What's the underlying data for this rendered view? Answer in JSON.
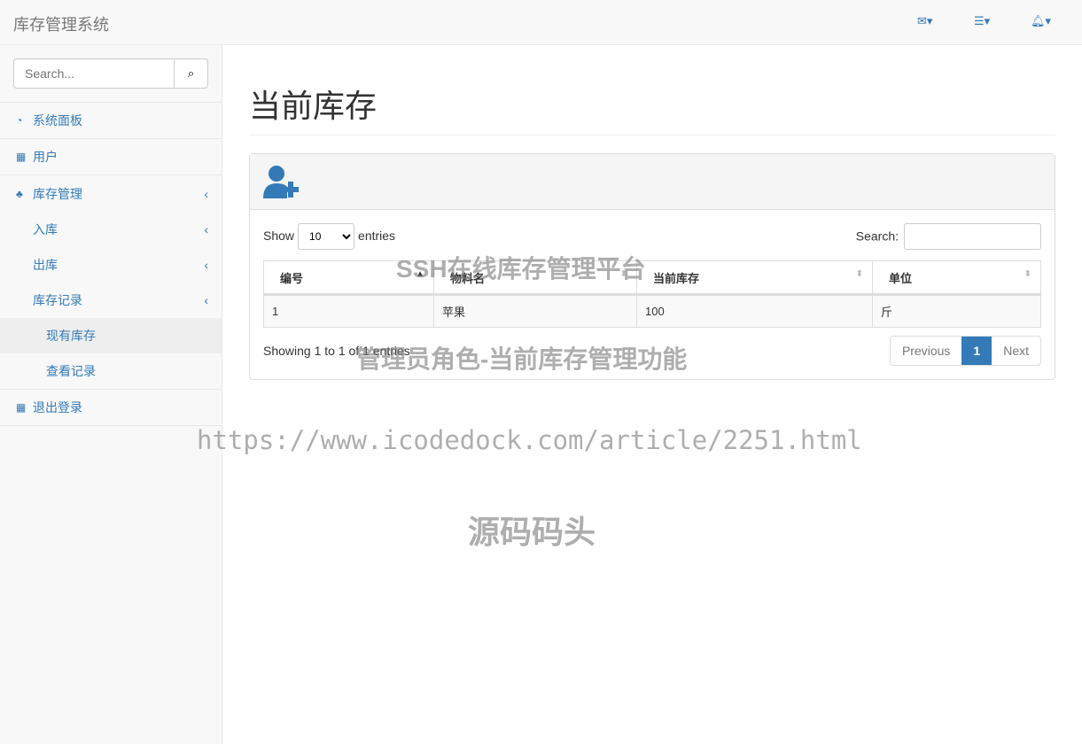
{
  "navbar": {
    "brand": "库存管理系统",
    "icons": [
      "envelope-icon",
      "tasks-icon",
      "bell-icon"
    ]
  },
  "sidebar": {
    "search_placeholder": "Search...",
    "items": [
      {
        "label": "系统面板",
        "icon": "dashboard-icon"
      },
      {
        "label": "用户",
        "icon": "table-icon"
      },
      {
        "label": "库存管理",
        "icon": "sitemap-icon"
      },
      {
        "label": "入库"
      },
      {
        "label": "出库"
      },
      {
        "label": "库存记录"
      },
      {
        "label": "现有库存",
        "active": true
      },
      {
        "label": "查看记录"
      },
      {
        "label": "退出登录",
        "icon": "table-icon"
      }
    ]
  },
  "main": {
    "title": "当前库存",
    "show": "Show",
    "entries": "entries",
    "length": "10",
    "search_label": "Search:",
    "columns": [
      "编号",
      "物料名",
      "当前库存",
      "单位"
    ],
    "rows": [
      [
        "1",
        "苹果",
        "100",
        "斤"
      ]
    ],
    "info": "Showing 1 to 1 of 1 entries",
    "prev": "Previous",
    "page": "1",
    "next": "Next"
  },
  "watermarks": [
    "SSH在线库存管理平台",
    "管理员角色-当前库存管理功能",
    "https://www.icodedock.com/article/2251.html",
    "源码码头"
  ]
}
